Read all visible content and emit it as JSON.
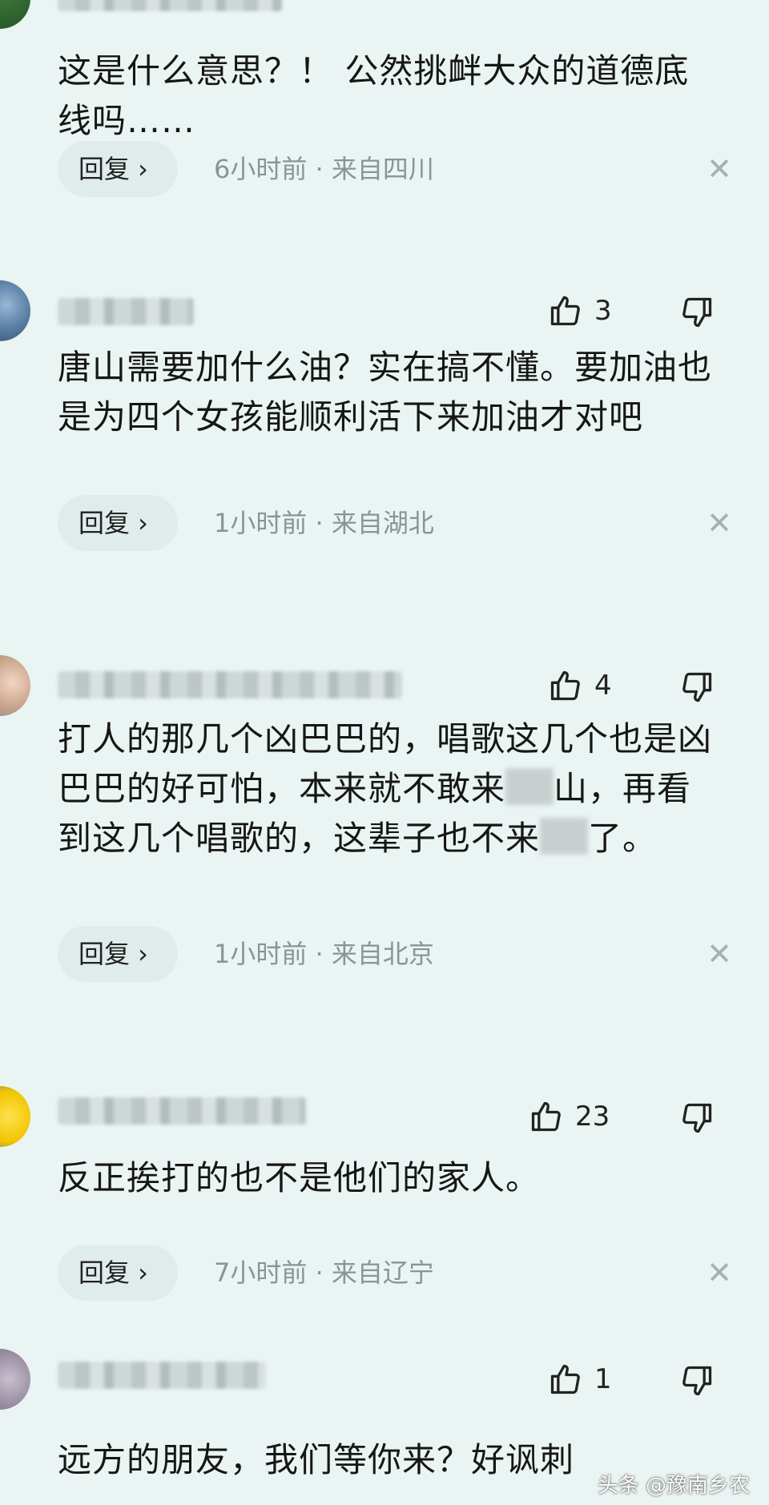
{
  "comments": [
    {
      "text": "这是什么意思？！ 公然挑衅大众的道德底线吗……",
      "reply_label": "回复 ›",
      "meta": "6小时前 · 来自四川",
      "close": "✕"
    },
    {
      "likes": "3",
      "text": "唐山需要加什么油？实在搞不懂。要加油也是为四个女孩能顺利活下来加油才对吧",
      "reply_label": "回复 ›",
      "meta": "1小时前 · 来自湖北",
      "close": "✕"
    },
    {
      "likes": "4",
      "text_a": "打人的那几个凶巴巴的，唱歌这几个也是凶巴巴的好可怕，本来就不敢来",
      "text_b": "山，再看到这几个唱歌的，这辈子也不来",
      "text_c": "了。",
      "reply_label": "回复 ›",
      "meta": "1小时前 · 来自北京",
      "close": "✕"
    },
    {
      "likes": "23",
      "text": "反正挨打的也不是他们的家人。",
      "reply_label": "回复 ›",
      "meta": "7小时前 · 来自辽宁",
      "close": "✕"
    },
    {
      "likes": "1",
      "text": "远方的朋友，我们等你来？好讽刺"
    }
  ],
  "watermark": "头条 @豫南乡农",
  "colors": {
    "background": "#eaf4f3",
    "meta": "#8a9494",
    "reply_bg": "#e0eceb"
  }
}
